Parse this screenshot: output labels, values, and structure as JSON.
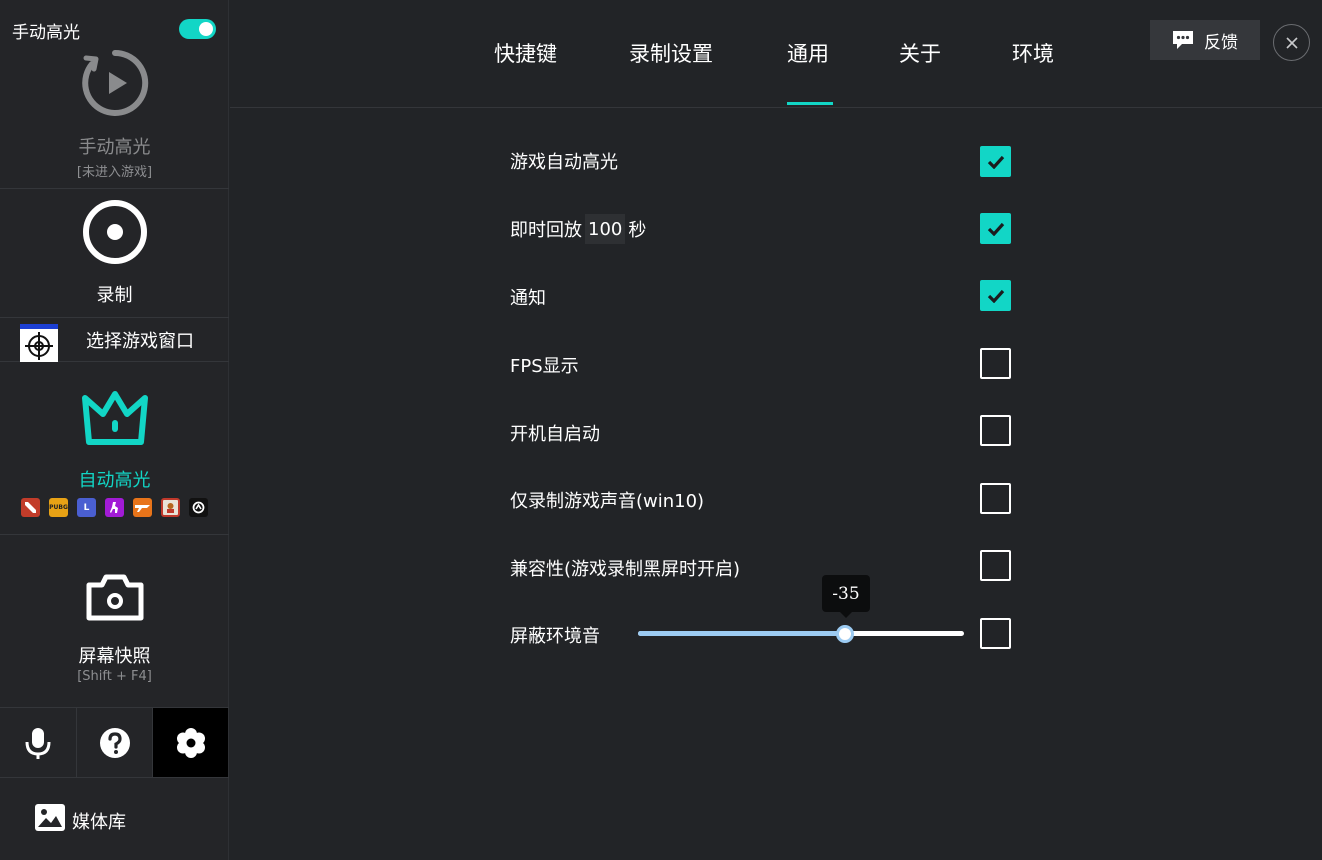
{
  "sidebar": {
    "manual": {
      "toggle_label": "手动高光",
      "toggle_on": true,
      "title": "手动高光",
      "subtitle": "[未进入游戏]"
    },
    "record": {
      "title": "录制"
    },
    "select_window": {
      "label": "选择游戏窗口"
    },
    "auto": {
      "title": "自动高光",
      "games": [
        {
          "icon": "dota2-icon",
          "color": "#c23c2a"
        },
        {
          "icon": "pubg-icon",
          "color": "#e8a215",
          "text": "PUBG"
        },
        {
          "icon": "lol-icon",
          "color": "#4a5fd1",
          "text": "L"
        },
        {
          "icon": "csgo-icon",
          "color": "#a21bd6"
        },
        {
          "icon": "crossfire-icon",
          "color": "#e8741a"
        },
        {
          "icon": "game-character-icon",
          "color": "#c0392b"
        },
        {
          "icon": "overwatch-icon",
          "color": "#111111"
        }
      ]
    },
    "screenshot": {
      "title": "屏幕快照",
      "shortcut": "[Shift + F4]"
    },
    "tools": [
      {
        "icon": "microphone-icon"
      },
      {
        "icon": "help-icon"
      },
      {
        "icon": "settings-icon",
        "active": true
      }
    ],
    "media": {
      "label": "媒体库"
    }
  },
  "tabs": [
    {
      "label": "快捷键"
    },
    {
      "label": "录制设置"
    },
    {
      "label": "通用",
      "active": true
    },
    {
      "label": "关于"
    },
    {
      "label": "环境"
    }
  ],
  "header": {
    "feedback_label": "反馈"
  },
  "settings": {
    "game_auto_highlight": {
      "label": "游戏自动高光",
      "checked": true
    },
    "instant_replay": {
      "prefix": "即时回放",
      "value": "100",
      "suffix": "秒",
      "checked": true
    },
    "notification": {
      "label": "通知",
      "checked": true
    },
    "fps_display": {
      "label": "FPS显示",
      "checked": false
    },
    "auto_start": {
      "label": "开机自启动",
      "checked": false
    },
    "game_audio_only": {
      "label": "仅录制游戏声音(win10)",
      "checked": false
    },
    "compatibility": {
      "label": "兼容性(游戏录制黑屏时开启)",
      "checked": false
    },
    "ambient_mute": {
      "label": "屏蔽环境音",
      "checked": false,
      "slider_value": "-35",
      "slider_fraction": 0.64
    }
  },
  "colors": {
    "accent": "#12d6c6",
    "background": "#222427",
    "slider_fill": "#9ccbf2"
  }
}
